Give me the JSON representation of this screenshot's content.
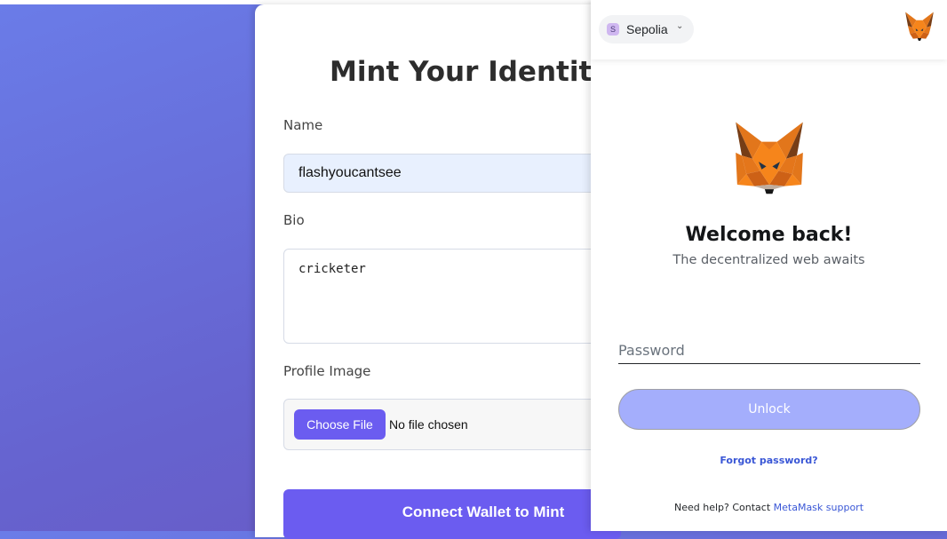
{
  "dapp": {
    "title": "Mint Your Identity N",
    "name_label": "Name",
    "name_value": "flashyoucantsee",
    "bio_label": "Bio",
    "bio_value": "cricketer",
    "image_label": "Profile Image",
    "choose_file": "Choose File",
    "no_file": "No file chosen",
    "connect_button": "Connect Wallet to Mint"
  },
  "metamask": {
    "network": {
      "badge": "S",
      "name": "Sepolia",
      "chevron": "⌄"
    },
    "welcome": "Welcome back!",
    "tagline": "The decentralized web awaits",
    "password_placeholder": "Password",
    "unlock": "Unlock",
    "forgot": "Forgot password?",
    "help_prefix": "Need help? Contact",
    "help_link": "MetaMask support",
    "icons": {
      "header": "metamask-fox-icon",
      "logo": "metamask-fox-logo"
    }
  },
  "colors": {
    "accent": "#6b5cf0",
    "unlock_disabled": "#a4aefc",
    "link": "#3a57d6",
    "bg_gradient_start": "#6a7ce8",
    "bg_gradient_end": "#6a55bf"
  }
}
